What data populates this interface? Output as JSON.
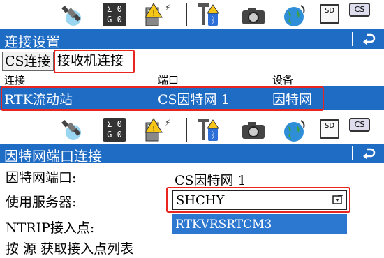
{
  "top_screen": {
    "title": "连接设置",
    "tabs": [
      {
        "label": "CS连接"
      },
      {
        "label": "接收机连接"
      }
    ],
    "columns": {
      "connection": "连接",
      "port": "端口",
      "device": "设备"
    },
    "selected_row": {
      "connection": "RTK流动站",
      "port": "CS因特网 1",
      "device": "因特网"
    }
  },
  "bottom_screen": {
    "title": "因特网端口连接",
    "fields": {
      "internet_port_label": "因特网端口:",
      "internet_port_value": "CS因特网 1",
      "server_label": "使用服务器:",
      "server_value": "SHCHY",
      "ntrip_label": "NTRIP接入点:",
      "ntrip_value": "RTKVRSRTCM3",
      "fetch_text": "按 源 获取接入点列表"
    }
  },
  "status_icons": {
    "satellite_counts": [
      "Σ 0",
      "G 0"
    ],
    "sd_label": "SD",
    "cs_label": "CS"
  },
  "colors": {
    "accent_blue": "#1f6cc5",
    "highlight_red": "#e8251f"
  }
}
